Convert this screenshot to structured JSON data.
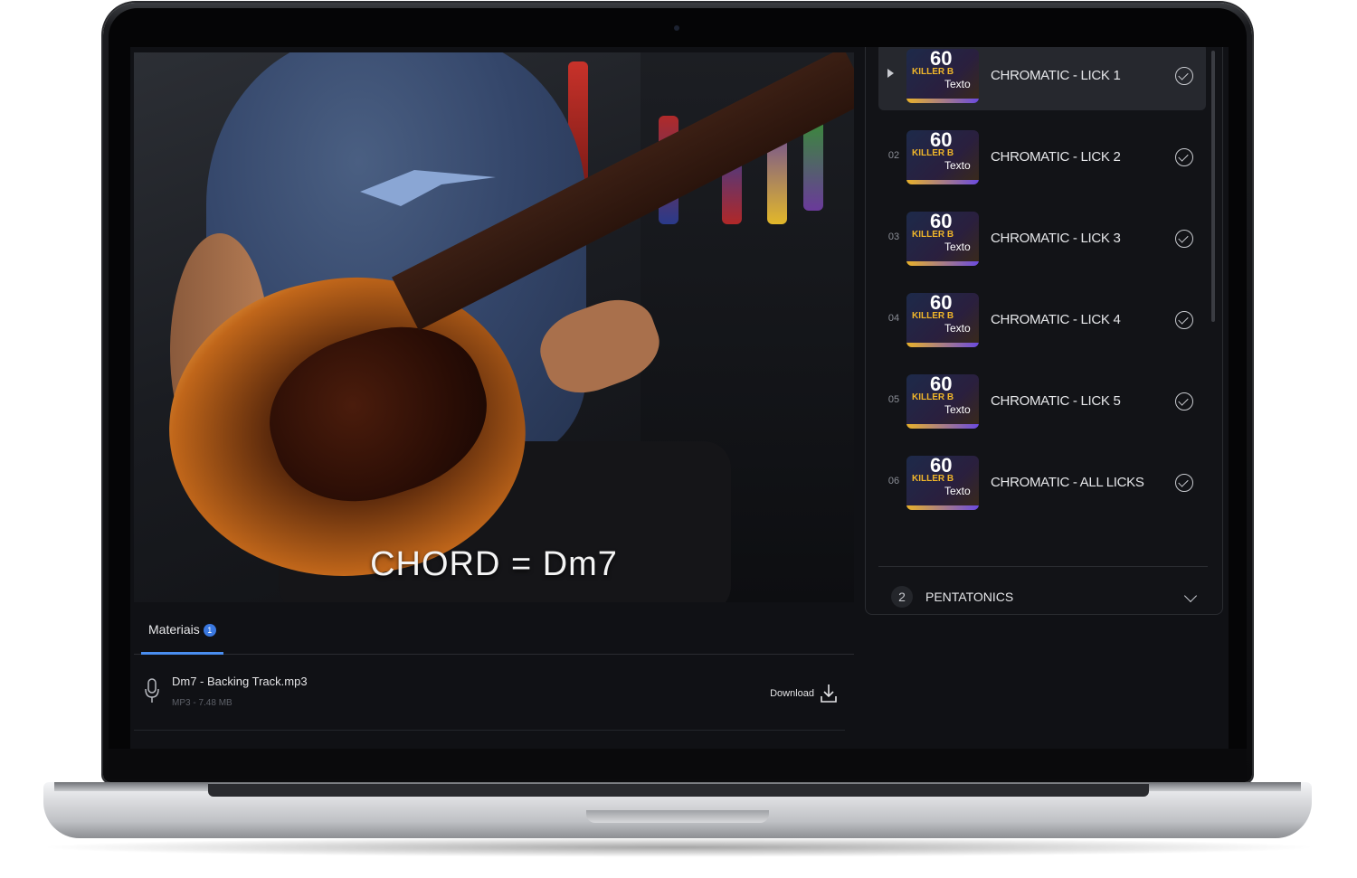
{
  "video": {
    "caption": "CHORD = Dm7"
  },
  "materials": {
    "tab_label": "Materiais",
    "tab_count": "1",
    "file": {
      "name": "Dm7 - Backing Track.mp3",
      "meta": "MP3 - 7.48 MB",
      "download_label": "Download"
    }
  },
  "sidebar": {
    "lessons": [
      {
        "number": "",
        "title": "CHROMATIC - LICK 1",
        "active": true,
        "completed": true
      },
      {
        "number": "02",
        "title": "CHROMATIC - LICK 2",
        "active": false,
        "completed": true
      },
      {
        "number": "03",
        "title": "CHROMATIC - LICK 3",
        "active": false,
        "completed": true
      },
      {
        "number": "04",
        "title": "CHROMATIC - LICK 4",
        "active": false,
        "completed": true
      },
      {
        "number": "05",
        "title": "CHROMATIC - LICK 5",
        "active": false,
        "completed": true
      },
      {
        "number": "06",
        "title": "CHROMATIC - ALL LICKS",
        "active": false,
        "completed": true
      }
    ],
    "thumbnail": {
      "big_number": "60",
      "title_word": "KILLER B",
      "overlay_text": "Texto"
    },
    "section": {
      "number": "2",
      "title": "PENTATONICS"
    }
  },
  "colors": {
    "accent": "#4a8ef0",
    "background": "#101115",
    "active_item": "#26282e"
  }
}
